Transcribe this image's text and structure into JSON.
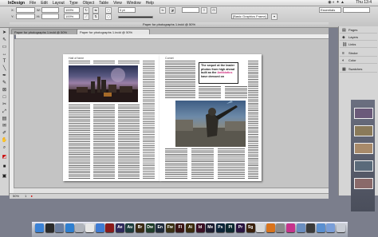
{
  "menubar": {
    "items": [
      "InDesign",
      "File",
      "Edit",
      "Layout",
      "Type",
      "Object",
      "Table",
      "View",
      "Window",
      "Help"
    ],
    "clock": "Thu 13:4",
    "workspace": "Essentials"
  },
  "control": {
    "x_label": "X:",
    "y_label": "Y:",
    "w_label": "W:",
    "h_label": "H:",
    "x_value": "",
    "y_value": "",
    "percent_1": "100%",
    "percent_2": "100%",
    "stroke_weight": "0 pt",
    "style_value": "[Basic Graphics Frame]"
  },
  "document": {
    "title": "Paper for photographs 1.indd @ 50%",
    "tabs": [
      {
        "label": "Paper for photographs 1.indd @ 50%",
        "active": false
      },
      {
        "label": "Paper for photographs 1.indd @ 50%",
        "active": true
      }
    ],
    "left_page": {
      "header": "Hall of fame",
      "column_count": 3
    },
    "right_page": {
      "header": "Comet",
      "column_count": 3
    },
    "pull_quote": {
      "line1": "The sequel at the leader",
      "line2": "photos from high ahead",
      "line3": "built as the",
      "highlight": "Antibiotics",
      "line4": "have dressed on",
      "line5": "it's"
    },
    "zoom": "50%",
    "page_nav": "1"
  },
  "panels": {
    "items": [
      {
        "label": "Pages",
        "icon": "pages-icon"
      },
      {
        "label": "Layers",
        "icon": "layers-icon"
      },
      {
        "label": "Links",
        "icon": "links-icon"
      },
      {
        "label": "Stroke",
        "icon": "stroke-icon"
      },
      {
        "label": "Color",
        "icon": "color-icon"
      },
      {
        "label": "Swatches",
        "icon": "swatches-icon"
      }
    ]
  },
  "dock": {
    "icons": [
      {
        "name": "finder-icon",
        "color": "#3b82d6",
        "glyph": ""
      },
      {
        "name": "dashboard-icon",
        "color": "#2a2a2a",
        "glyph": ""
      },
      {
        "name": "mission-control-icon",
        "color": "#6a7ea0",
        "glyph": ""
      },
      {
        "name": "safari-icon",
        "color": "#2f7fd0",
        "glyph": ""
      },
      {
        "name": "mail-icon",
        "color": "#b0b4bc",
        "glyph": ""
      },
      {
        "name": "ical-icon",
        "color": "#e8e8e8",
        "glyph": ""
      },
      {
        "name": "app-store-icon",
        "color": "#3e7bd4",
        "glyph": ""
      },
      {
        "name": "acrobat-icon",
        "color": "#8a1a1a",
        "glyph": ""
      },
      {
        "name": "after-effects-icon",
        "color": "#2e2a5c",
        "glyph": "Ae"
      },
      {
        "name": "audition-icon",
        "color": "#1c3c3c",
        "glyph": "Au"
      },
      {
        "name": "bridge-icon",
        "color": "#3a2a14",
        "glyph": "Br"
      },
      {
        "name": "dreamweaver-icon",
        "color": "#1f3d2a",
        "glyph": "Dw"
      },
      {
        "name": "encore-icon",
        "color": "#1f2a3a",
        "glyph": "En"
      },
      {
        "name": "fireworks-icon",
        "color": "#3a3014",
        "glyph": "Fw"
      },
      {
        "name": "flash-icon",
        "color": "#3a1414",
        "glyph": "Fl"
      },
      {
        "name": "illustrator-icon",
        "color": "#3a2a0c",
        "glyph": "Ai"
      },
      {
        "name": "indesign-icon",
        "color": "#3a0f24",
        "glyph": "Id"
      },
      {
        "name": "media-encoder-icon",
        "color": "#1c1c30",
        "glyph": "Me"
      },
      {
        "name": "photoshop-icon",
        "color": "#0c2438",
        "glyph": "Ps"
      },
      {
        "name": "prelude-icon",
        "color": "#0c2830",
        "glyph": "Pl"
      },
      {
        "name": "premiere-icon",
        "color": "#2a1440",
        "glyph": "Pr"
      },
      {
        "name": "speedgrade-icon",
        "color": "#3a200c",
        "glyph": "Sg"
      },
      {
        "name": "chrome-icon",
        "color": "#d8d8d8",
        "glyph": ""
      },
      {
        "name": "firefox-icon",
        "color": "#d9731c",
        "glyph": ""
      },
      {
        "name": "system-prefs-icon",
        "color": "#8a8a8a",
        "glyph": ""
      },
      {
        "name": "itunes-icon",
        "color": "#c6338c",
        "glyph": ""
      },
      {
        "name": "preview-icon",
        "color": "#6a8ec0",
        "glyph": ""
      },
      {
        "name": "calculator-icon",
        "color": "#3a3a3a",
        "glyph": ""
      },
      {
        "name": "downloads-icon",
        "color": "#5a8fd0",
        "glyph": ""
      },
      {
        "name": "documents-icon",
        "color": "#7a9ed8",
        "glyph": ""
      },
      {
        "name": "trash-icon",
        "color": "#c8ccd4",
        "glyph": ""
      }
    ]
  }
}
